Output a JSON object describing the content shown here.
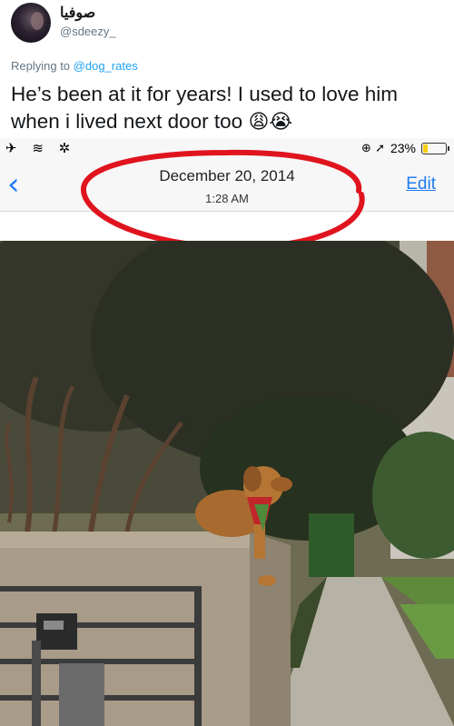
{
  "tweet": {
    "display_name": "صوفيا",
    "handle": "@sdeezy_",
    "replying_prefix": "Replying to",
    "replying_to": "@dog_rates",
    "text": "He’s been at it for years! I used to love him when i lived next door too",
    "emojis": "😩😭"
  },
  "phone": {
    "status_left": "✈ ≋ ✲",
    "status_location": "⊕ ➚",
    "battery_percent": "23%",
    "battery_level": 0.23,
    "back_icon": "‹",
    "date": "December 20, 2014",
    "time": "1:28 AM",
    "edit_label": "Edit"
  },
  "colors": {
    "link_blue": "#1da1f2",
    "ios_blue": "#1f7cf2",
    "circle_red": "#e0141e",
    "battery_yellow": "#f5cf12"
  }
}
